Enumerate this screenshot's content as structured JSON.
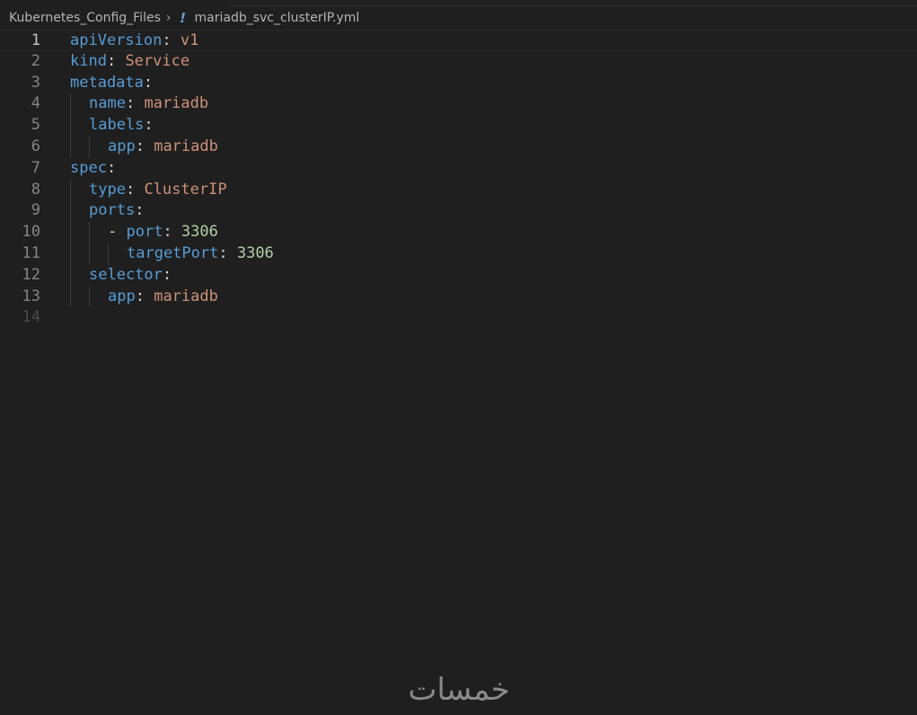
{
  "breadcrumb": {
    "folder": "Kubernetes_Config_Files",
    "separator_icon": "chevron-right-icon",
    "file_icon": "yaml-file-icon",
    "file": "mariadb_svc_clusterIP.yml"
  },
  "editor": {
    "current_line": 1,
    "lines": [
      {
        "num": "1",
        "key": "apiVersion",
        "sep": ": ",
        "val": "v1",
        "val_type": "string"
      },
      {
        "num": "2",
        "key": "kind",
        "sep": ": ",
        "val": "Service",
        "val_type": "string"
      },
      {
        "num": "3",
        "key": "metadata",
        "sep": ":",
        "val": "",
        "val_type": "string"
      },
      {
        "num": "4",
        "key": "name",
        "sep": ": ",
        "val": "mariadb",
        "val_type": "string"
      },
      {
        "num": "5",
        "key": "labels",
        "sep": ":",
        "val": "",
        "val_type": "string"
      },
      {
        "num": "6",
        "key": "app",
        "sep": ": ",
        "val": "mariadb",
        "val_type": "string"
      },
      {
        "num": "7",
        "key": "spec",
        "sep": ":",
        "val": "",
        "val_type": "string"
      },
      {
        "num": "8",
        "key": "type",
        "sep": ": ",
        "val": "ClusterIP",
        "val_type": "string"
      },
      {
        "num": "9",
        "key": "ports",
        "sep": ":",
        "val": "",
        "val_type": "string"
      },
      {
        "num": "10",
        "dash": "- ",
        "key": "port",
        "sep": ": ",
        "val": "3306",
        "val_type": "number"
      },
      {
        "num": "11",
        "key": "targetPort",
        "sep": ": ",
        "val": "3306",
        "val_type": "number"
      },
      {
        "num": "12",
        "key": "selector",
        "sep": ":",
        "val": "",
        "val_type": "string"
      },
      {
        "num": "13",
        "key": "app",
        "sep": ": ",
        "val": "mariadb",
        "val_type": "string"
      },
      {
        "num": "14",
        "key": "",
        "sep": "",
        "val": "",
        "val_type": "string"
      }
    ]
  },
  "colors": {
    "background": "#1f1f1f",
    "key": "#569cd6",
    "string": "#ce9178",
    "number": "#b5cea8"
  },
  "watermark": "خمسات"
}
